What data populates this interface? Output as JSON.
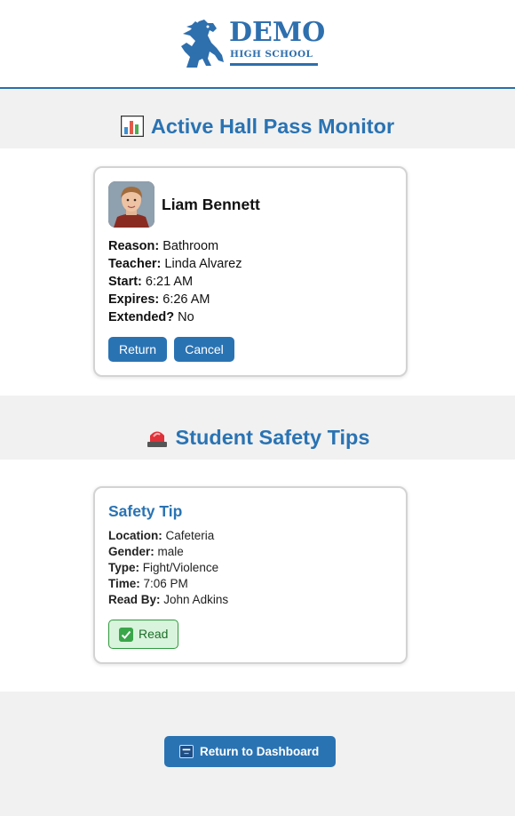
{
  "header": {
    "logo_title": "DEMO",
    "logo_subtitle": "HIGH SCHOOL"
  },
  "hall_pass_section": {
    "title": "Active Hall Pass Monitor",
    "icon": "bar-chart-icon",
    "student_name": "Liam Bennett",
    "reason_label": "Reason:",
    "reason": "Bathroom",
    "teacher_label": "Teacher:",
    "teacher": "Linda Alvarez",
    "start_label": "Start:",
    "start": "6:21 AM",
    "expires_label": "Expires:",
    "expires": "6:26 AM",
    "extended_label": "Extended?",
    "extended": "No",
    "return_button": "Return",
    "cancel_button": "Cancel"
  },
  "safety_section": {
    "title": "Student Safety Tips",
    "icon": "siren-icon",
    "tip_title": "Safety Tip",
    "location_label": "Location:",
    "location": "Cafeteria",
    "gender_label": "Gender:",
    "gender": "male",
    "type_label": "Type:",
    "type": "Fight/Violence",
    "time_label": "Time:",
    "time": "7:06 PM",
    "read_by_label": "Read By:",
    "read_by": "John Adkins",
    "read_badge": "Read"
  },
  "footer": {
    "dashboard_button": "Return to Dashboard"
  },
  "colors": {
    "accent": "#2a73b3",
    "page_bg": "#f1f1f1",
    "read_green": "#2e9a3e"
  }
}
